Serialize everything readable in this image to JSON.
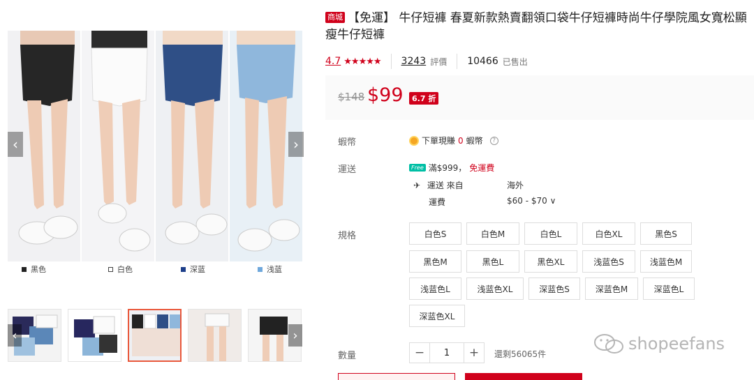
{
  "gallery": {
    "legend": [
      {
        "label": "黑色",
        "color": "#222222"
      },
      {
        "label": "白色",
        "color": "#ffffff"
      },
      {
        "label": "深蓝",
        "color": "#1d3f8a"
      },
      {
        "label": "浅蓝",
        "color": "#6fa8dc"
      }
    ],
    "prev_arrow": "‹",
    "next_arrow": "›"
  },
  "product": {
    "mall_badge": "商城",
    "title": "【免運】 牛仔短褲 春夏新款熱賣翻領口袋牛仔短褲時尚牛仔學院風女寬松顯瘦牛仔短褲",
    "rating": "4.7",
    "stars": "★★★★★",
    "review_count": "3243",
    "review_label": "評價",
    "sold_count": "10466",
    "sold_label": "已售出",
    "old_price": "$148",
    "price": "$99",
    "discount": "6.7 折"
  },
  "labels": {
    "coins": "蝦幣",
    "shipping": "運送",
    "spec": "規格",
    "quantity": "數量"
  },
  "coins": {
    "text_before": "下單現賺",
    "amount": "0",
    "text_after": "蝦幣",
    "help": "?"
  },
  "shipping": {
    "free_badge": "Free",
    "threshold": "滿$999，",
    "free_text": "免運費",
    "from_label": "運送 來自",
    "from_value": "海外",
    "fee_label": "運費",
    "fee_value": "$60 - $70 ∨"
  },
  "variants": [
    "白色S",
    "白色M",
    "白色L",
    "白色XL",
    "黑色S",
    "黑色M",
    "黑色L",
    "黑色XL",
    "浅蓝色S",
    "浅蓝色M",
    "浅蓝色L",
    "浅蓝色XL",
    "深蓝色S",
    "深蓝色M",
    "深蓝色L",
    "深蓝色XL"
  ],
  "quantity": {
    "minus": "−",
    "value": "1",
    "plus": "+",
    "stock": "還剩56065件"
  },
  "watermark": "shopeefans",
  "colors": {
    "brand_red": "#d0011b",
    "thumb_selected": "#e9583b",
    "free_green": "#00bfa5"
  }
}
